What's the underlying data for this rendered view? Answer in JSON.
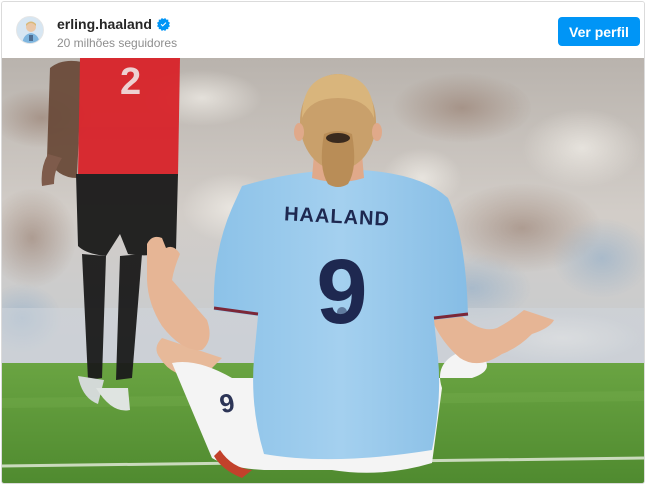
{
  "post": {
    "username": "erling.haaland",
    "verified": true,
    "followers_text": "20 milhões seguidores",
    "profile_button_label": "Ver perfil",
    "icons": {
      "verified": "verified-badge-icon"
    },
    "photo": {
      "jersey_name": "HAALAND",
      "jersey_number": "9",
      "opponent_number": "2",
      "shorts_number": "9"
    }
  },
  "colors": {
    "accent": "#0095f6",
    "username": "#262626",
    "muted": "#8e8e8e"
  }
}
